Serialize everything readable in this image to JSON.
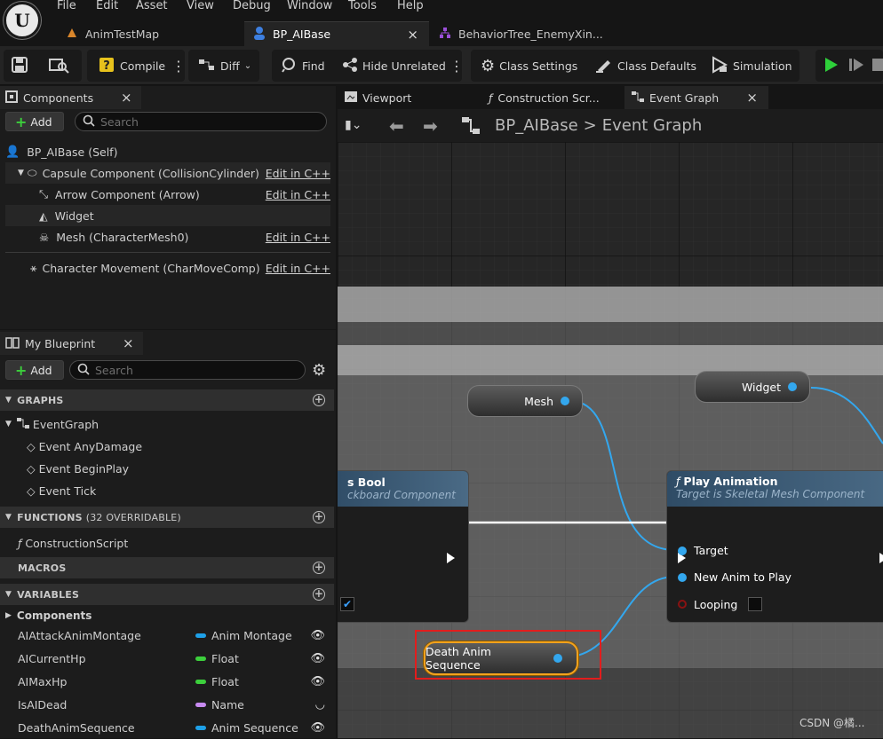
{
  "menu": [
    "File",
    "Edit",
    "Asset",
    "View",
    "Debug",
    "Window",
    "Tools",
    "Help"
  ],
  "doc_tabs": [
    {
      "label": "AnimTestMap",
      "icon": "level-icon",
      "active": false
    },
    {
      "label": "BP_AIBase",
      "icon": "blueprint-icon",
      "active": true,
      "close": "×"
    },
    {
      "label": "BehaviorTree_EnemyXin...",
      "icon": "behavior-tree-icon",
      "active": false
    }
  ],
  "toolbar": {
    "compile": "Compile",
    "diff": "Diff",
    "find": "Find",
    "hide_unrelated": "Hide Unrelated",
    "class_settings": "Class Settings",
    "class_defaults": "Class Defaults",
    "simulation": "Simulation"
  },
  "components_panel": {
    "title": "Components",
    "close": "×",
    "add": "Add",
    "search_placeholder": "Search",
    "items": [
      {
        "label": "BP_AIBase (Self)",
        "edit": ""
      },
      {
        "label": "Capsule Component (CollisionCylinder)",
        "edit": "Edit in C++"
      },
      {
        "label": "Arrow Component (Arrow)",
        "edit": "Edit in C++"
      },
      {
        "label": "Widget",
        "edit": ""
      },
      {
        "label": "Mesh (CharacterMesh0)",
        "edit": "Edit in C++"
      },
      {
        "label": "Character Movement (CharMoveComp)",
        "edit": "Edit in C++"
      }
    ]
  },
  "my_blueprint": {
    "title": "My Blueprint",
    "close": "×",
    "add": "Add",
    "search_placeholder": "Search",
    "graphs_label": "GRAPHS",
    "event_graph": "EventGraph",
    "events": [
      "Event AnyDamage",
      "Event BeginPlay",
      "Event Tick"
    ],
    "functions_label": "FUNCTIONS",
    "functions_count": "(32 OVERRIDABLE)",
    "construction_script": "ConstructionScript",
    "macros_label": "MACROS",
    "variables_label": "VARIABLES",
    "components_category": "Components",
    "variables": [
      {
        "name": "AIAttackAnimMontage",
        "type": "Anim Montage",
        "color": "#1ea0e8"
      },
      {
        "name": "AICurrentHp",
        "type": "Float",
        "color": "#3ccf3c"
      },
      {
        "name": "AIMaxHp",
        "type": "Float",
        "color": "#3ccf3c"
      },
      {
        "name": "IsAIDead",
        "type": "Name",
        "color": "#c78af0"
      },
      {
        "name": "DeathAnimSequence",
        "type": "Anim Sequence",
        "color": "#1ea0e8"
      }
    ]
  },
  "editor_tabs": [
    {
      "label": "Viewport"
    },
    {
      "label": "Construction Scr..."
    },
    {
      "label": "Event Graph",
      "close": "×"
    }
  ],
  "breadcrumb": {
    "root": "BP_AIBase",
    "sep": ">",
    "current": "Event Graph"
  },
  "graph": {
    "mesh_node": "Mesh",
    "widget_node": "Widget",
    "left_node_title": "s Bool",
    "left_node_subtitle": "ckboard Component",
    "play_anim_title": "Play Animation",
    "play_anim_subtitle": "Target is Skeletal Mesh Component",
    "pin_target": "Target",
    "pin_new_anim": "New Anim to Play",
    "pin_looping": "Looping",
    "death_node": "Death Anim Sequence"
  },
  "watermark": "CSDN @橘..."
}
